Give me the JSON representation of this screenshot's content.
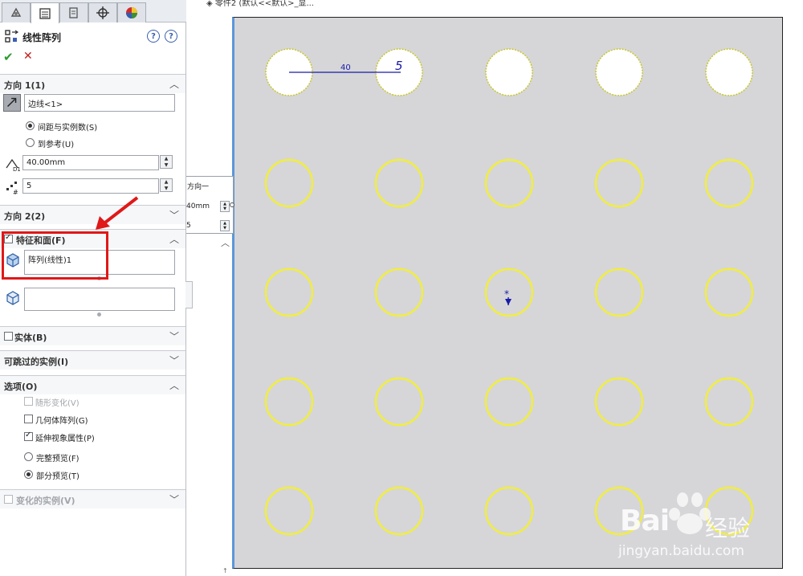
{
  "panel": {
    "title": "线性阵列",
    "help_label": "?",
    "info_label": "?",
    "ok_label": "✔",
    "cancel_label": "✕",
    "direction1": {
      "header": "方向 1(1)",
      "edge_value": "边线<1>",
      "radio_spacing": "间距与实例数(S)",
      "radio_reference": "到参考(U)",
      "spacing_value": "40.00mm",
      "count_value": "5"
    },
    "direction2": {
      "header": "方向 2(2)"
    },
    "features": {
      "header": "特征和面(F)",
      "feature_item": "阵列(线性)1",
      "faces_value": ""
    },
    "bodies": {
      "header": "实体(B)"
    },
    "skip": {
      "header": "可跳过的实例(I)"
    },
    "options": {
      "header": "选项(O)",
      "vary_sketch": "随形变化(V)",
      "geometry_pattern": "几何体阵列(G)",
      "propagate_visual": "延伸视象属性(P)",
      "full_preview": "完整预览(F)",
      "partial_preview": "部分预览(T)"
    },
    "varied": {
      "header": "变化的实例(V)"
    }
  },
  "flyout": {
    "title": "方向一",
    "spacing": "40mm",
    "count": "5"
  },
  "canvas": {
    "breadcrumb": "零件2 (默认<<默认>_显...",
    "dim_spacing": "40",
    "dim_count": "5"
  },
  "watermark": {
    "brand": "Bai",
    "sub": "经验",
    "url": "jingyan.baidu.com"
  },
  "colors": {
    "accent_red": "#e01818",
    "ok_green": "#2c9b2c",
    "pattern_yellow": "#f2ee3a",
    "dim_blue": "#1a1aa8"
  }
}
